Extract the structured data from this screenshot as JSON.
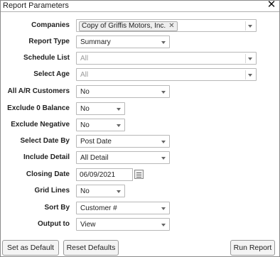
{
  "dialog": {
    "title": "Report Parameters"
  },
  "fields": {
    "companies": {
      "label": "Companies",
      "tag": "Copy of Griffis Motors, Inc."
    },
    "report_type": {
      "label": "Report Type",
      "value": "Summary"
    },
    "schedule_list": {
      "label": "Schedule List",
      "placeholder": "All"
    },
    "select_age": {
      "label": "Select Age",
      "placeholder": "All"
    },
    "all_ar_customers": {
      "label": "All A/R Customers",
      "value": "No"
    },
    "exclude_zero_balance": {
      "label": "Exclude 0 Balance",
      "value": "No"
    },
    "exclude_negative": {
      "label": "Exclude Negative",
      "value": "No"
    },
    "select_date_by": {
      "label": "Select Date By",
      "value": "Post Date"
    },
    "include_detail": {
      "label": "Include Detail",
      "value": "All Detail"
    },
    "closing_date": {
      "label": "Closing Date",
      "value": "06/09/2021"
    },
    "grid_lines": {
      "label": "Grid Lines",
      "value": "No"
    },
    "sort_by": {
      "label": "Sort By",
      "value": "Customer #"
    },
    "output_to": {
      "label": "Output to",
      "value": "View"
    }
  },
  "buttons": {
    "set_default": "Set as Default",
    "reset_defaults": "Reset Defaults",
    "run_report": "Run Report"
  },
  "icons": {
    "close": "close-icon",
    "calendar": "calendar-icon",
    "tag_remove": "remove-tag-icon",
    "dropdown": "chevron-down-icon"
  }
}
